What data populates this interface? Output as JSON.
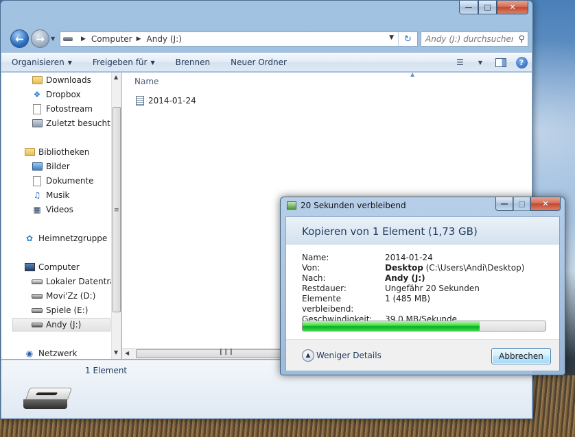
{
  "explorer": {
    "address": {
      "crumbs": [
        "Computer",
        "Andy (J:)"
      ]
    },
    "search_placeholder": "Andy (J:) durchsuchen",
    "toolbar": {
      "organize": "Organisieren",
      "share": "Freigeben für",
      "burn": "Brennen",
      "new_folder": "Neuer Ordner"
    },
    "nav": {
      "favorites": [
        {
          "label": "Downloads",
          "icon": "downloads-folder-icon"
        },
        {
          "label": "Dropbox",
          "icon": "dropbox-icon"
        },
        {
          "label": "Fotostream",
          "icon": "photostream-icon"
        },
        {
          "label": "Zuletzt besucht",
          "icon": "recent-places-icon"
        }
      ],
      "libraries_label": "Bibliotheken",
      "libraries": [
        {
          "label": "Bilder",
          "icon": "pictures-icon"
        },
        {
          "label": "Dokumente",
          "icon": "documents-icon"
        },
        {
          "label": "Musik",
          "icon": "music-icon"
        },
        {
          "label": "Videos",
          "icon": "videos-icon"
        }
      ],
      "homegroup": "Heimnetzgruppe",
      "computer_label": "Computer",
      "drives": [
        {
          "label": "Lokaler Datenträg",
          "icon": "local-disk-icon"
        },
        {
          "label": "Movi'Zz (D:)",
          "icon": "drive-icon"
        },
        {
          "label": "Spiele (E:)",
          "icon": "drive-icon"
        },
        {
          "label": "Andy (J:)",
          "icon": "usb-drive-icon",
          "selected": true
        }
      ],
      "network": "Netzwerk"
    },
    "content": {
      "column_name": "Name",
      "files": [
        {
          "name": "2014-01-24",
          "icon": "file-icon"
        }
      ]
    },
    "details": {
      "item_count": "1 Element"
    }
  },
  "copy_dialog": {
    "title": "20 Sekunden verbleibend",
    "heading": "Kopieren von 1 Element (1,73 GB)",
    "rows": [
      {
        "label": "Name:",
        "value": "2014-01-24"
      },
      {
        "label": "Von:",
        "value_bold": "Desktop",
        "value": "(C:\\Users\\Andi\\Desktop)"
      },
      {
        "label": "Nach:",
        "value_bold": "Andy (J:)"
      },
      {
        "label": "Restdauer:",
        "value": "Ungefähr 20 Sekunden"
      },
      {
        "label": "Elemente verbleibend:",
        "value": "1 (485 MB)"
      },
      {
        "label": "Geschwindigkeit:",
        "value": "39,0 MB/Sekunde"
      }
    ],
    "progress_fraction": 0.73,
    "progress_color": "#06b025",
    "less_details": "Weniger Details",
    "cancel": "Abbrechen"
  }
}
